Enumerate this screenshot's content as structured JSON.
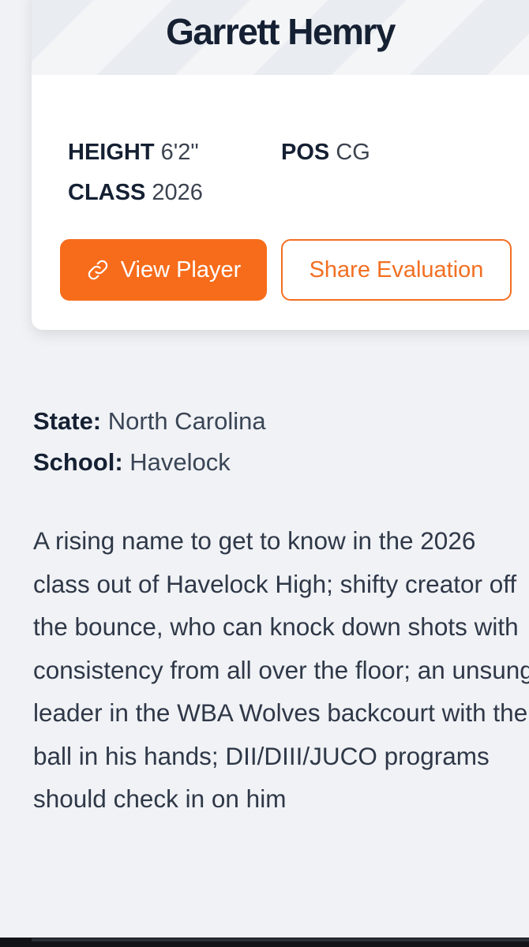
{
  "player": {
    "name": "Garrett Hemry",
    "height_label": "HEIGHT",
    "height_value": "6'2\"",
    "pos_label": "POS",
    "pos_value": "CG",
    "class_label": "CLASS",
    "class_value": "2026"
  },
  "actions": {
    "view_player_label": "View Player",
    "view_player_icon": "link-icon",
    "share_evaluation_label": "Share Evaluation"
  },
  "details": {
    "state_label": "State:",
    "state_value": "North Carolina",
    "school_label": "School:",
    "school_value": "Havelock"
  },
  "evaluation": {
    "text": "A rising name to get to know in the 2026 class out of Havelock High; shifty creator off the bounce, who can knock down shots with consistency from all over the floor; an unsung leader in the WBA Wolves backcourt with the ball in his hands; DII/DIII/JUCO programs should check in on him"
  },
  "colors": {
    "accent": "#f76c1b",
    "name_text": "#152033",
    "background": "#f0f2f5"
  }
}
